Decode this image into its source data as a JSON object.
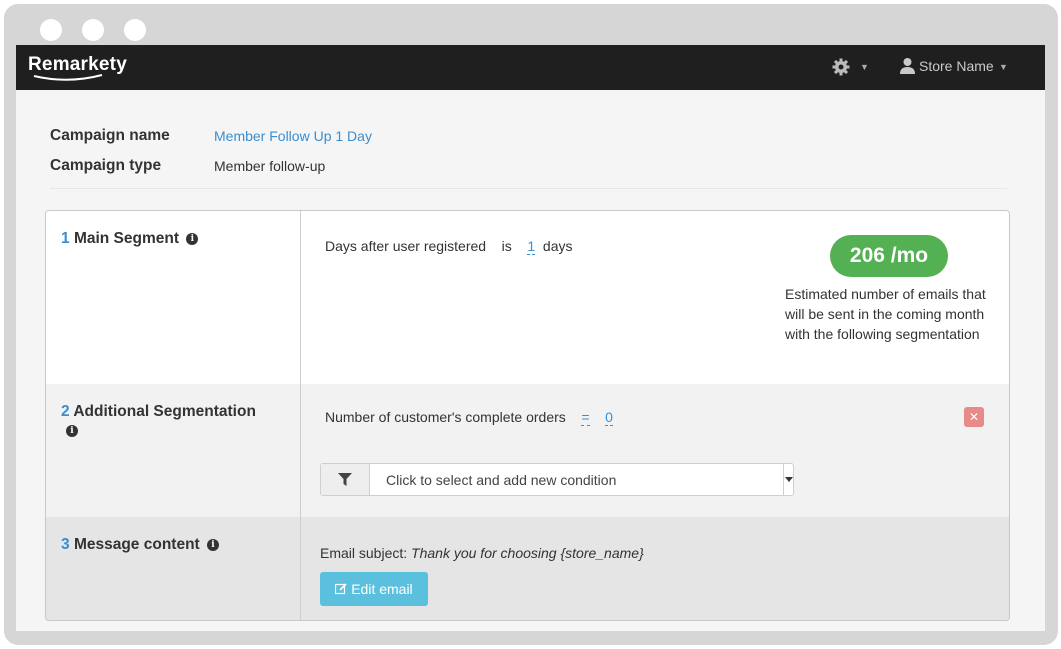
{
  "navbar": {
    "logo_text": "Remarkety",
    "user_label": "Store Name"
  },
  "campaign": {
    "name_label": "Campaign name",
    "name_value": "Member Follow Up 1 Day",
    "type_label": "Campaign type",
    "type_value": "Member follow-up"
  },
  "sections": {
    "main_segment": {
      "number": "1",
      "title": "Main Segment",
      "condition_label": "Days after user registered",
      "operator": "is",
      "value": "1",
      "unit": "days",
      "estimate": "206 /mo",
      "estimate_description": "Estimated number of emails that will be sent in the coming month with the following segmentation"
    },
    "additional_segmentation": {
      "number": "2",
      "title": "Additional Segmentation",
      "condition_label": "Number of customer's complete orders",
      "operator": "=",
      "value": "0",
      "select_placeholder": "Click to select and add new condition"
    },
    "message_content": {
      "number": "3",
      "title": "Message content",
      "subject_label": "Email subject:",
      "subject_value": "Thank you for choosing {store_name}",
      "edit_button": "Edit email"
    }
  },
  "colors": {
    "accent": "#3a8ed0",
    "badge": "#53b154",
    "edit_button": "#5bc0de",
    "remove_button": "#e68a8a",
    "navbar": "#1f1f1f"
  }
}
